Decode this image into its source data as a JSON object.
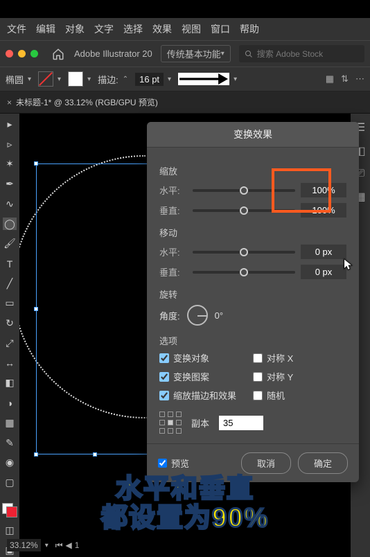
{
  "menubar": [
    "文件",
    "编辑",
    "对象",
    "文字",
    "选择",
    "效果",
    "视图",
    "窗口",
    "帮助"
  ],
  "app": {
    "title": "Adobe Illustrator 20",
    "workspace": "传统基本功能",
    "search_placeholder": "搜索 Adobe Stock"
  },
  "optionsbar": {
    "shape_label": "椭圆",
    "stroke_label": "描边:",
    "stroke_value": "16 pt"
  },
  "doc_tab": {
    "label": "未标题-1* @ 33.12% (RGB/GPU 预览)"
  },
  "dialog": {
    "title": "变换效果",
    "sections": {
      "scale": {
        "label": "缩放",
        "h_label": "水平:",
        "v_label": "垂直:",
        "h_value": "100%",
        "v_value": "100%"
      },
      "move": {
        "label": "移动",
        "h_label": "水平:",
        "v_label": "垂直:",
        "h_value": "0 px",
        "v_value": "0 px"
      },
      "rotate": {
        "label": "旋转",
        "angle_label": "角度:",
        "angle_value": "0°"
      },
      "options": {
        "label": "选项",
        "transform_objects": "变换对象",
        "transform_patterns": "变换图案",
        "scale_strokes": "缩放描边和效果",
        "reflect_x": "对称 X",
        "reflect_y": "对称 Y",
        "random": "随机"
      },
      "copies": {
        "label": "副本",
        "value": "35"
      }
    },
    "preview_label": "预览",
    "cancel": "取消",
    "ok": "确定"
  },
  "status": {
    "zoom": "33.12%",
    "page": "1"
  },
  "caption": {
    "line1": "水平和垂直",
    "line2": "都设置为90%"
  }
}
